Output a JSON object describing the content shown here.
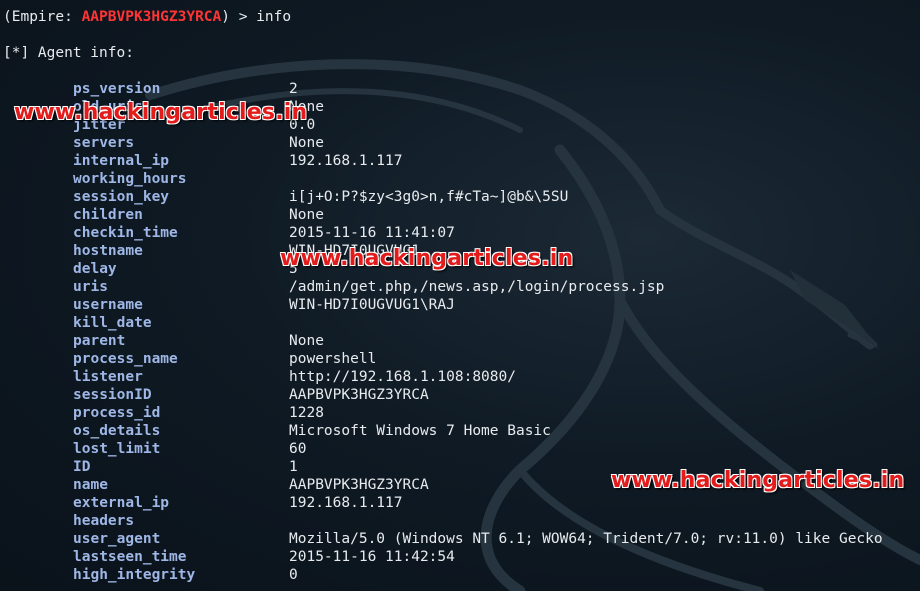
{
  "prompt": {
    "prefix": "(Empire: ",
    "agent": "AAPBVPK3HGZ3YRCA",
    "suffix": ") > info"
  },
  "header": "[*] Agent info:",
  "rows": [
    {
      "key": "ps_version",
      "value": "2"
    },
    {
      "key": "old_uris",
      "value": "None"
    },
    {
      "key": "jitter",
      "value": "0.0"
    },
    {
      "key": "servers",
      "value": "None"
    },
    {
      "key": "internal_ip",
      "value": "192.168.1.117"
    },
    {
      "key": "working_hours",
      "value": ""
    },
    {
      "key": "session_key",
      "value": "i[j+O:P?$zy<3g0>n,f#cTa~]@b&\\5SU"
    },
    {
      "key": "children",
      "value": "None"
    },
    {
      "key": "checkin_time",
      "value": "2015-11-16 11:41:07"
    },
    {
      "key": "hostname",
      "value": "WIN-HD7I0UGVUG1"
    },
    {
      "key": "delay",
      "value": "5"
    },
    {
      "key": "uris",
      "value": "/admin/get.php,/news.asp,/login/process.jsp"
    },
    {
      "key": "username",
      "value": "WIN-HD7I0UGVUG1\\RAJ"
    },
    {
      "key": "kill_date",
      "value": ""
    },
    {
      "key": "parent",
      "value": "None"
    },
    {
      "key": "process_name",
      "value": "powershell"
    },
    {
      "key": "listener",
      "value": "http://192.168.1.108:8080/"
    },
    {
      "key": "sessionID",
      "value": "AAPBVPK3HGZ3YRCA"
    },
    {
      "key": "process_id",
      "value": "1228"
    },
    {
      "key": "os_details",
      "value": "Microsoft Windows 7 Home Basic"
    },
    {
      "key": "lost_limit",
      "value": "60"
    },
    {
      "key": "ID",
      "value": "1"
    },
    {
      "key": "name",
      "value": "AAPBVPK3HGZ3YRCA"
    },
    {
      "key": "external_ip",
      "value": "192.168.1.117"
    },
    {
      "key": "headers",
      "value": ""
    },
    {
      "key": "user_agent",
      "value": "Mozilla/5.0 (Windows NT 6.1; WOW64; Trident/7.0; rv:11.0) like Gecko"
    },
    {
      "key": "lastseen_time",
      "value": "2015-11-16 11:42:54"
    },
    {
      "key": "high_integrity",
      "value": "0"
    }
  ],
  "watermarks": [
    "www.hackingarticles.in",
    "www.hackingarticles.in",
    "www.hackingarticles.in"
  ],
  "colors": {
    "background": "#0f1a24",
    "key": "#9fb7e6",
    "value": "#e8ebee",
    "agent": "#ff3434",
    "watermark": "#e31b1b"
  }
}
